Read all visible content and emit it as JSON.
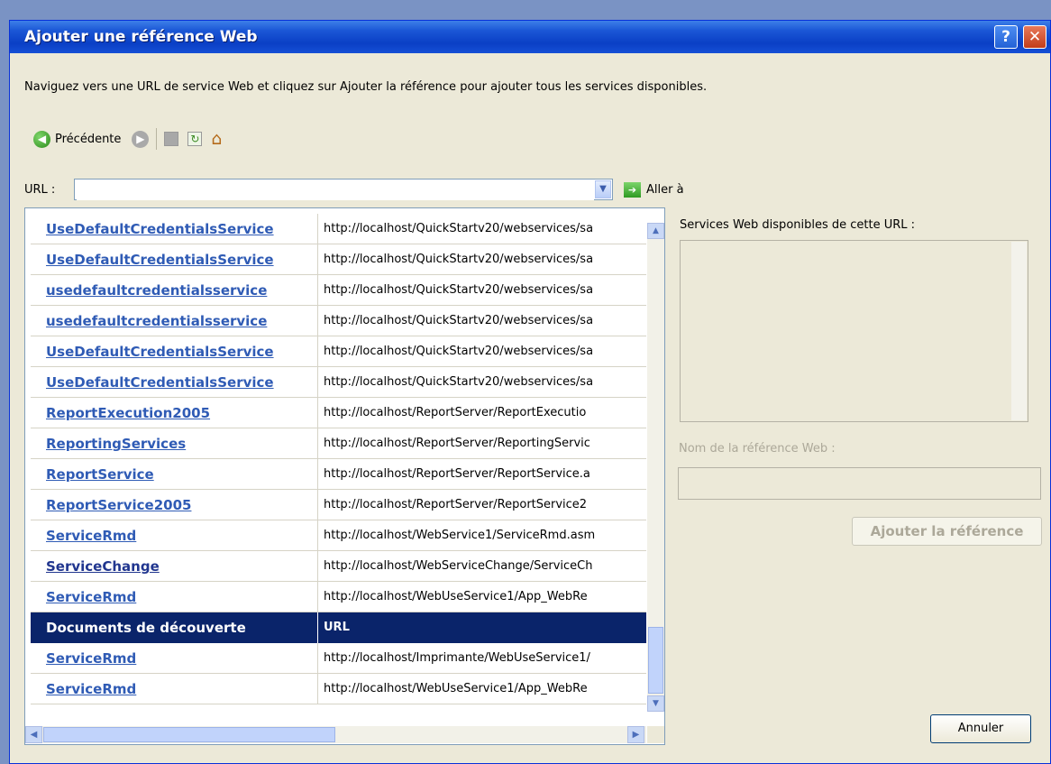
{
  "window": {
    "title": "Ajouter une référence Web",
    "help": "?",
    "close": "✕"
  },
  "description": "Naviguez vers une URL de service Web et cliquez sur Ajouter la référence pour ajouter tous les services disponibles.",
  "toolbar": {
    "back_label": "Précédente"
  },
  "url": {
    "label": "URL :",
    "value": "",
    "go_label": "Aller à"
  },
  "results": [
    {
      "name": "UseDefaultCredentialsService",
      "url": "http://localhost/QuickStartv20/webservices/sa"
    },
    {
      "name": "UseDefaultCredentialsService",
      "url": "http://localhost/QuickStartv20/webservices/sa"
    },
    {
      "name": "usedefaultcredentialsservice",
      "url": "http://localhost/QuickStartv20/webservices/sa"
    },
    {
      "name": "usedefaultcredentialsservice",
      "url": "http://localhost/QuickStartv20/webservices/sa"
    },
    {
      "name": "UseDefaultCredentialsService",
      "url": "http://localhost/QuickStartv20/webservices/sa"
    },
    {
      "name": "UseDefaultCredentialsService",
      "url": "http://localhost/QuickStartv20/webservices/sa"
    },
    {
      "name": "ReportExecution2005",
      "url": "http://localhost/ReportServer/ReportExecutio"
    },
    {
      "name": "ReportingServices",
      "url": "http://localhost/ReportServer/ReportingServic"
    },
    {
      "name": "ReportService",
      "url": "http://localhost/ReportServer/ReportService.a"
    },
    {
      "name": "ReportService2005",
      "url": "http://localhost/ReportServer/ReportService2"
    },
    {
      "name": "ServiceRmd",
      "url": "http://localhost/WebService1/ServiceRmd.asm"
    },
    {
      "name": "ServiceChange",
      "url": "http://localhost/WebServiceChange/ServiceCh"
    },
    {
      "name": "ServiceRmd",
      "url": "http://localhost/WebUseService1/App_WebRe"
    }
  ],
  "discovery_header": {
    "name": "Documents de découverte",
    "url": "URL"
  },
  "discovery": [
    {
      "name": "ServiceRmd",
      "url": "http://localhost/Imprimante/WebUseService1/"
    },
    {
      "name": "ServiceRmd",
      "url": "http://localhost/WebUseService1/App_WebRe"
    }
  ],
  "right": {
    "available_label": "Services Web disponibles de cette URL :",
    "refname_label": "Nom de la référence Web :",
    "add_button": "Ajouter la référence",
    "cancel_button": "Annuler"
  }
}
